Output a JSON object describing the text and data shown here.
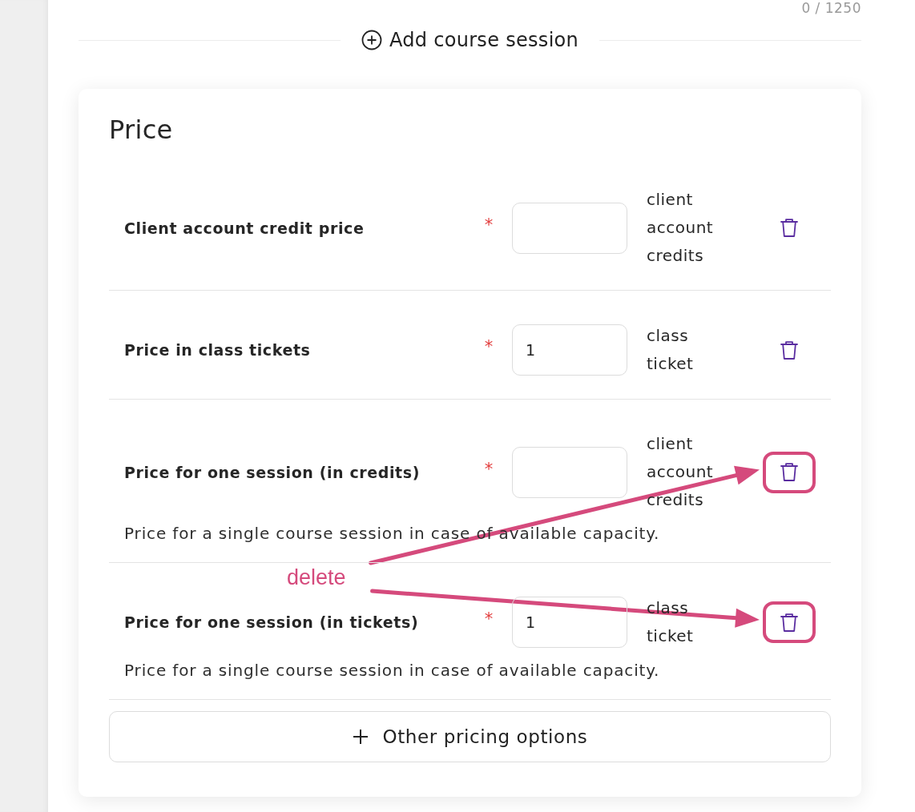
{
  "counter": "0 / 1250",
  "add_session": {
    "label": "Add course session"
  },
  "price": {
    "title": "Price",
    "rows": [
      {
        "label": "Client account credit price",
        "required": true,
        "required_mark": "*",
        "unit": "client account credits",
        "highlighted": false
      },
      {
        "label": "Price in class tickets",
        "required": true,
        "required_mark": "*",
        "value": "1",
        "unit": "class ticket",
        "highlighted": false
      },
      {
        "label": "Price for one session (in credits)",
        "required": true,
        "required_mark": "*",
        "unit": "client account credits",
        "description": "Price for a single course session in case of available capacity.",
        "highlighted": true
      },
      {
        "label": "Price for one session (in tickets)",
        "required": true,
        "required_mark": "*",
        "value": "1",
        "unit": "class ticket",
        "description": "Price for a single course session in case of available capacity.",
        "highlighted": true
      }
    ],
    "other_options": {
      "label": "Other pricing options"
    }
  },
  "annotation": {
    "label": "delete"
  }
}
